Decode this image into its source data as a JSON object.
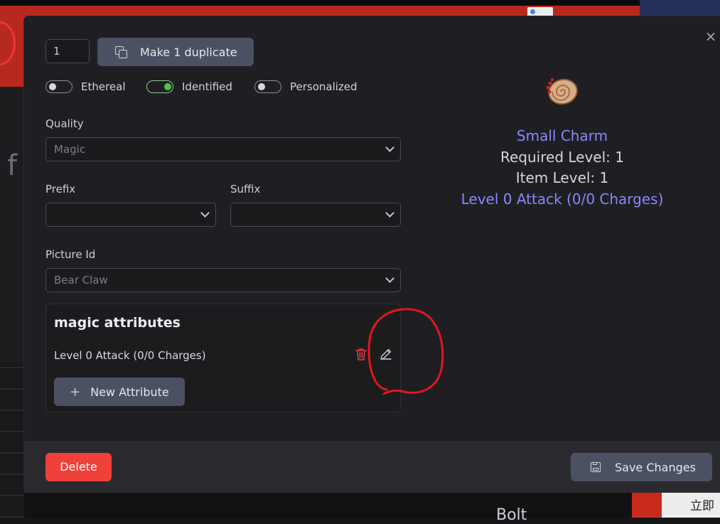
{
  "background": {
    "fragment_left": "f",
    "fragment_bottom": "Bolt",
    "fragment_bottom_right": "立即"
  },
  "modal": {
    "close_glyph": "×",
    "duplicate": {
      "count_value": "1",
      "button_label": "Make 1 duplicate",
      "icon": "copy-icon"
    },
    "toggles": [
      {
        "label": "Ethereal",
        "on": false
      },
      {
        "label": "Identified",
        "on": true
      },
      {
        "label": "Personalized",
        "on": false
      }
    ],
    "quality": {
      "label": "Quality",
      "value": "Magic"
    },
    "prefix": {
      "label": "Prefix",
      "value": ""
    },
    "suffix": {
      "label": "Suffix",
      "value": ""
    },
    "picture": {
      "label": "Picture Id",
      "value": "Bear Claw"
    },
    "attributes": {
      "title": "magic attributes",
      "rows": [
        {
          "text": "Level 0 Attack (0/0 Charges)"
        }
      ],
      "new_button_label": "New Attribute",
      "new_button_icon": "plus-icon",
      "delete_icon": "trash-icon",
      "edit_icon": "pencil-icon"
    },
    "preview": {
      "image": "small-charm-image",
      "name": "Small Charm",
      "required_level": "Required Level: 1",
      "item_level": "Item Level: 1",
      "magic_line": "Level 0 Attack (0/0 Charges)",
      "name_color": "#8a86ff"
    },
    "footer": {
      "delete_label": "Delete",
      "save_label": "Save Changes",
      "save_icon": "save-icon"
    }
  },
  "colors": {
    "accent_green": "#54c24a",
    "danger_red": "#f0403a",
    "magic_blue": "#8a86ff",
    "annotation_red": "#e3161b"
  }
}
